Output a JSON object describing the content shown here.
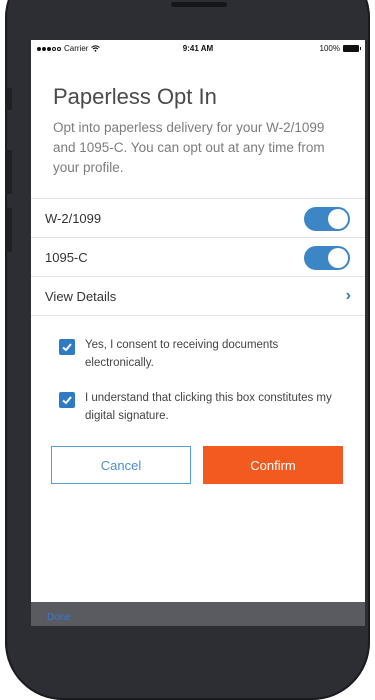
{
  "status_bar": {
    "carrier": "Carrier",
    "wifi_icon": "wifi-icon",
    "time": "9:41 AM",
    "battery": "100%"
  },
  "title": "Paperless Opt In",
  "description": "Opt into paperless delivery for your W-2/1099 and 1095-C. You can opt out at any time from your profile.",
  "settings": [
    {
      "label": "W-2/1099",
      "enabled": true
    },
    {
      "label": "1095-C",
      "enabled": true
    }
  ],
  "details": {
    "label": "View Details",
    "icon": "chevron-right-icon"
  },
  "consents": [
    {
      "label": "Yes, I consent to receiving documents electronically.",
      "checked": true
    },
    {
      "label": "I understand that clicking this box constitutes my digital signature.",
      "checked": true
    }
  ],
  "buttons": {
    "cancel": "Cancel",
    "confirm": "Confirm"
  },
  "colors": {
    "accent": "#2e7bc4",
    "confirm": "#f25a1f",
    "toggle": "#3d86c6"
  },
  "tab_bar": {
    "label": "Done"
  }
}
